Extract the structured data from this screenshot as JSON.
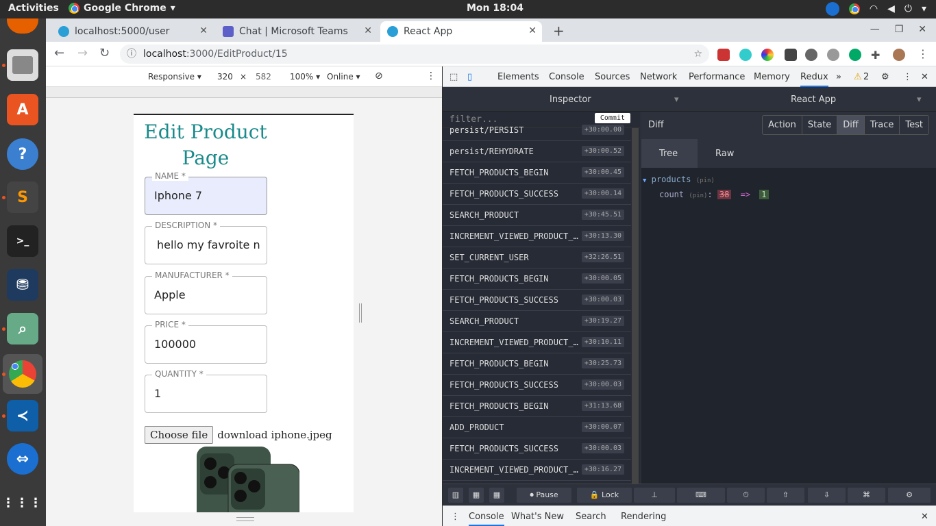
{
  "topbar": {
    "activities": "Activities",
    "app": "Google Chrome",
    "clock": "Mon 18:04"
  },
  "tabs": [
    {
      "title": "localhost:5000/user",
      "icon": "react-icon"
    },
    {
      "title": "Chat | Microsoft Teams",
      "icon": "teams-icon"
    },
    {
      "title": "React App",
      "icon": "react-icon"
    }
  ],
  "omnibox": {
    "host": "localhost",
    "path": ":3000/EditProduct/15"
  },
  "devbar": {
    "device": "Responsive ▾",
    "width": "320",
    "times": "×",
    "height": "582",
    "zoom": "100% ▾",
    "network": "Online ▾"
  },
  "form": {
    "title": "Edit Product Page",
    "fields": [
      {
        "label": "NAME *",
        "value": "Iphone 7"
      },
      {
        "label": "DESCRIPTION *",
        "value": "hello my favroite new"
      },
      {
        "label": "MANUFACTURER *",
        "value": "Apple"
      },
      {
        "label": "PRICE *",
        "value": "100000"
      },
      {
        "label": "QUANTITY *",
        "value": "1"
      }
    ],
    "file_button": "Choose file",
    "file_name": "download iphone.jpeg"
  },
  "devtools": {
    "tabs": [
      "Elements",
      "Console",
      "Sources",
      "Network",
      "Performance",
      "Memory",
      "Redux"
    ],
    "warnings": "2"
  },
  "redux": {
    "inspector": "Inspector",
    "instance": "React App",
    "filter_placeholder": "filter...",
    "commit": "Commit",
    "actions": [
      {
        "name": "persist/PERSIST",
        "time": "+30:00.00"
      },
      {
        "name": "persist/REHYDRATE",
        "time": "+30:00.52"
      },
      {
        "name": "FETCH_PRODUCTS_BEGIN",
        "time": "+30:00.45"
      },
      {
        "name": "FETCH_PRODUCTS_SUCCESS",
        "time": "+30:00.14"
      },
      {
        "name": "SEARCH_PRODUCT",
        "time": "+30:45.51"
      },
      {
        "name": "INCREMENT_VIEWED_PRODUCT_…",
        "time": "+30:13.30"
      },
      {
        "name": "SET_CURRENT_USER",
        "time": "+32:26.51"
      },
      {
        "name": "FETCH_PRODUCTS_BEGIN",
        "time": "+30:00.05"
      },
      {
        "name": "FETCH_PRODUCTS_SUCCESS",
        "time": "+30:00.03"
      },
      {
        "name": "SEARCH_PRODUCT",
        "time": "+30:19.27"
      },
      {
        "name": "INCREMENT_VIEWED_PRODUCT_…",
        "time": "+30:10.11"
      },
      {
        "name": "FETCH_PRODUCTS_BEGIN",
        "time": "+30:25.73"
      },
      {
        "name": "FETCH_PRODUCTS_SUCCESS",
        "time": "+30:00.03"
      },
      {
        "name": "FETCH_PRODUCTS_BEGIN",
        "time": "+31:13.68"
      },
      {
        "name": "ADD_PRODUCT",
        "time": "+30:00.07"
      },
      {
        "name": "FETCH_PRODUCTS_SUCCESS",
        "time": "+30:00.03"
      },
      {
        "name": "INCREMENT_VIEWED_PRODUCT_…",
        "time": "+30:16.27"
      }
    ],
    "diff_label": "Diff",
    "mode_buttons": [
      "Action",
      "State",
      "Diff",
      "Trace",
      "Test"
    ],
    "tree_tabs": [
      "Tree",
      "Raw"
    ],
    "tree": {
      "root": "products",
      "pin": "(pin)",
      "key": "count",
      "old": "38",
      "arrow": "=>",
      "new": "1"
    },
    "bottom": {
      "pause": "Pause",
      "lock": "Lock"
    }
  },
  "drawer": {
    "tabs": [
      "Console",
      "What's New",
      "Search",
      "Rendering"
    ]
  }
}
